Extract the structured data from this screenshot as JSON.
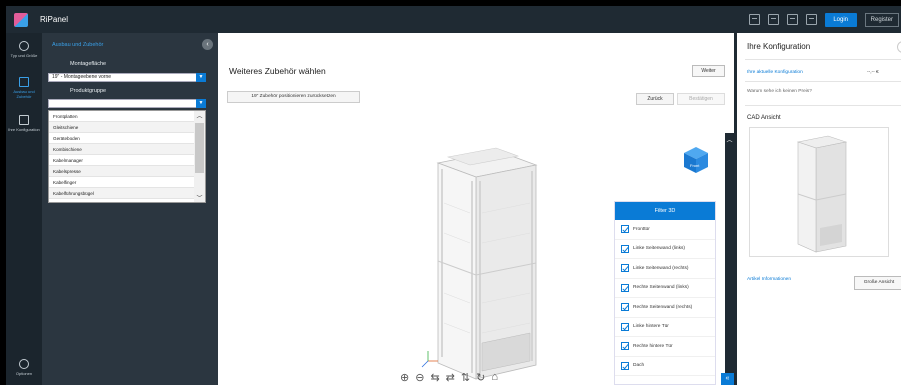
{
  "app": {
    "title": "RiPanel"
  },
  "topbar": {
    "icons": [
      "save-icon",
      "export-icon",
      "window-icon",
      "disk-icon"
    ],
    "login_label": "Login",
    "register_label": "Register"
  },
  "leftnav": {
    "items": [
      {
        "label": "Typ und Größe",
        "icon": "globe-icon"
      },
      {
        "label": "Ausbau und Zubehör",
        "icon": "rack-icon",
        "active": true
      },
      {
        "label": "Ihre Konfiguration",
        "icon": "document-icon"
      }
    ],
    "options_label": "Optionen"
  },
  "accessory_panel": {
    "header": "Ausbau und Zubehör",
    "mounting_label": "Montagefläche",
    "mounting_value": "19\" - Montageebene vorne",
    "group_label": "Produktgruppe",
    "group_value": "",
    "options": [
      "Frontplatten",
      "Gleitschiene",
      "Geräteboden",
      "Kombischiene",
      "Kabelmanager",
      "Kabelspresse",
      "Kabelfinger",
      "Kabelführungsbügel"
    ]
  },
  "main": {
    "title": "Weiteres Zubehör wählen",
    "next_label": "Weiter",
    "reset_label": "19\" Zubehör positionieren zurücksetzen",
    "back_label": "Zurück",
    "confirm_label": "Bestätigen",
    "cube_label": "Front",
    "filter": {
      "title": "Filter 3D",
      "items": [
        "Fronttür",
        "Linke Seitenwand (links)",
        "Linke Seitenwand (rechts)",
        "Rechte Seitenwand (links)",
        "Rechte Seitenwand (rechts)",
        "Linke hintere Tür",
        "Rechte hintere Tür",
        "Dach"
      ]
    },
    "toolbar_icons": [
      "zoom-in-icon",
      "zoom-out-icon",
      "rotate-left-icon",
      "rotate-right-icon",
      "rotate-up-icon",
      "rotate-down-icon",
      "home-icon"
    ]
  },
  "right_panel": {
    "title": "Ihre Konfiguration",
    "price_link": "Ihre aktuelle Konfiguration",
    "price_value": "--,-- €",
    "price_question": "Warum sehe ich keinen Preis?",
    "cad_title": "CAD Ansicht",
    "article_link": "Artikel Informationen",
    "large_view_label": "Große Ansicht"
  }
}
